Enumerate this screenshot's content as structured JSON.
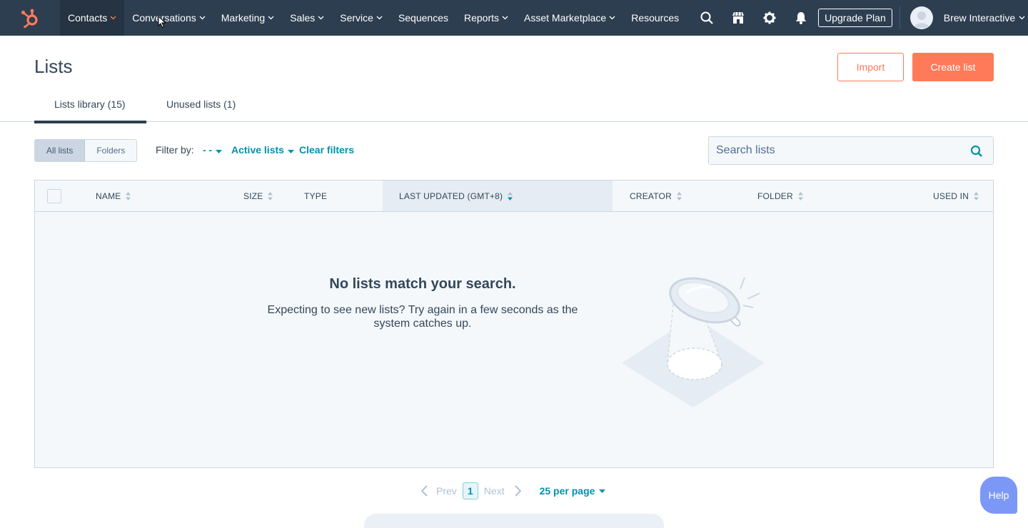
{
  "nav": {
    "items": [
      {
        "label": "Contacts",
        "has_menu": true
      },
      {
        "label": "Conversations",
        "has_menu": true
      },
      {
        "label": "Marketing",
        "has_menu": true
      },
      {
        "label": "Sales",
        "has_menu": true
      },
      {
        "label": "Service",
        "has_menu": true
      },
      {
        "label": "Sequences",
        "has_menu": false
      },
      {
        "label": "Reports",
        "has_menu": true
      },
      {
        "label": "Asset Marketplace",
        "has_menu": true
      },
      {
        "label": "Resources",
        "has_menu": false
      }
    ],
    "icons": [
      "search-icon",
      "marketplace-icon",
      "settings-gear-icon",
      "notifications-bell-icon"
    ],
    "upgrade_label": "Upgrade Plan",
    "account_name": "Brew Interactive",
    "colors": {
      "bar": "#2d3e50",
      "active": "#253342",
      "logo": "#ff7a59"
    }
  },
  "header": {
    "title": "Lists",
    "import_label": "Import",
    "create_label": "Create list"
  },
  "tabs": [
    {
      "label": "Lists library (15)",
      "active": true
    },
    {
      "label": "Unused lists (1)",
      "active": false
    }
  ],
  "filters": {
    "segments": [
      {
        "label": "All lists",
        "active": true
      },
      {
        "label": "Folders",
        "active": false
      }
    ],
    "filter_by_label": "Filter by:",
    "type_value": "- -",
    "active_lists_label": "Active lists",
    "clear_label": "Clear filters",
    "search_placeholder": "Search lists"
  },
  "table": {
    "columns": [
      {
        "label": "NAME",
        "sortable": true
      },
      {
        "label": "SIZE",
        "sortable": true
      },
      {
        "label": "TYPE",
        "sortable": false
      },
      {
        "label": "LAST UPDATED (GMT+8)",
        "sortable": true,
        "sorted": "desc"
      },
      {
        "label": "CREATOR",
        "sortable": true
      },
      {
        "label": "FOLDER",
        "sortable": true
      },
      {
        "label": "USED IN",
        "sortable": true
      }
    ],
    "empty_title": "No lists match your search.",
    "empty_message": "Expecting to see new lists? Try again in a few seconds as the system catches up."
  },
  "pagination": {
    "prev_label": "Prev",
    "current_page": "1",
    "next_label": "Next",
    "per_page_label": "25 per page"
  },
  "help_label": "Help",
  "accent": {
    "orange": "#ff7a59",
    "teal": "#0091ae",
    "help": "#7c98f6"
  }
}
